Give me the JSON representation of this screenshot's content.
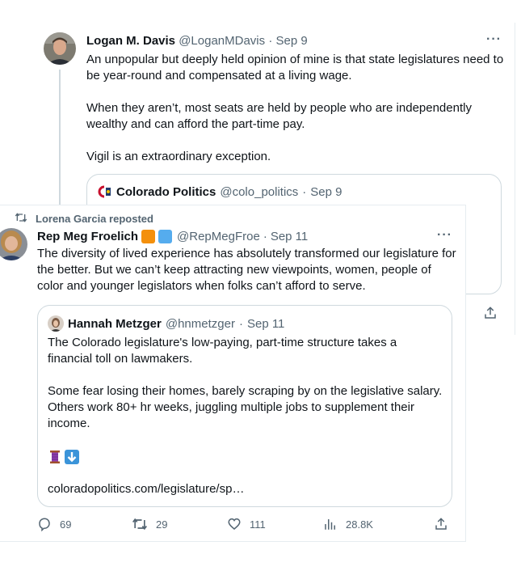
{
  "back_tweet": {
    "author_name": "Logan M. Davis",
    "author_handle": "@LoganMDavis",
    "separator": "·",
    "date": "Sep 9",
    "more_label": "···",
    "text": "An unpopular but deeply held opinion of mine is that state legislatures need to be year-round and compensated at a living wage.\n\nWhen they aren’t, most seats are held by people who are independently wealthy and can afford the part-time pay.\n\nVigil is an extraordinary exception.",
    "quote": {
      "author_name": "Colorado Politics",
      "author_handle": "@colo_politics",
      "date": "Sep 9",
      "logo_icon": "colorado-politics-logo"
    },
    "share_icon": "share-icon"
  },
  "front_tweet": {
    "repost_label": "Lorena Garcia reposted",
    "repost_icon": "repost-icon",
    "author_name": "Rep Meg Froelich",
    "badges": [
      {
        "icon": "orange-square-icon",
        "color": "#f4900c"
      },
      {
        "icon": "blue-square-icon",
        "color": "#55acee"
      }
    ],
    "author_handle": "@RepMegFroe",
    "separator": "·",
    "date": "Sep 11",
    "more_label": "···",
    "text": "The diversity of lived experience has absolutely transformed our legislature for the better. But we can’t keep attracting new viewpoints, women, people of color and younger legislators when folks can’t afford to serve.",
    "quote": {
      "author_name": "Hannah Metzger",
      "author_handle": "@hnmetzger",
      "date": "Sep 11",
      "text": "The Colorado legislature's low-paying, part-time structure takes a financial toll on lawmakers.\n\nSome fear losing their homes, barely scraping by on the legislative salary. Others work 80+ hr weeks, juggling multiple jobs to supplement their income.",
      "emojis": [
        "thread-spool-icon",
        "down-arrow-icon"
      ],
      "link": "coloradopolitics.com/legislature/sp…"
    },
    "actions": {
      "replies": "69",
      "reposts": "29",
      "likes": "111",
      "views": "28.8K"
    }
  },
  "colors": {
    "text": "#0f1419",
    "muted": "#536471",
    "border": "#cfd9de"
  }
}
